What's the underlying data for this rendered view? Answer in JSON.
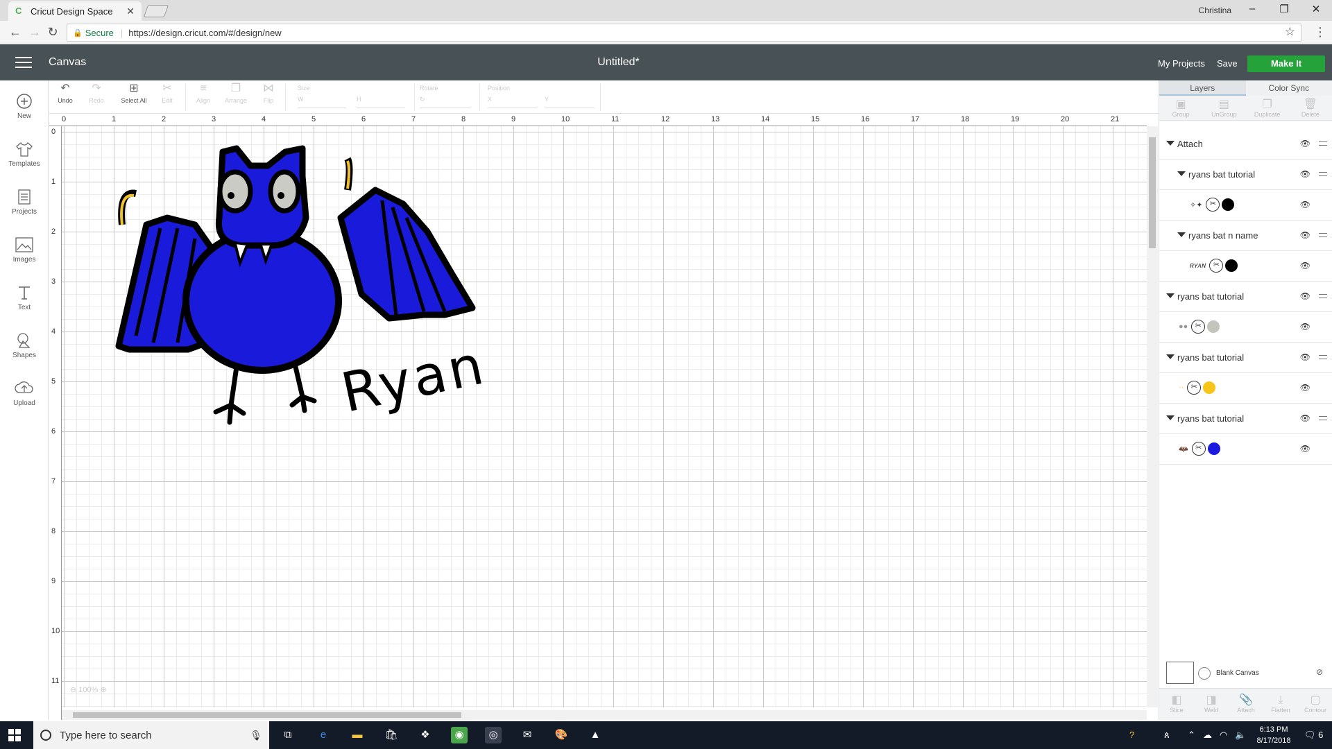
{
  "browser": {
    "tab_title": "Cricut Design Space",
    "user_name": "Christina",
    "secure_label": "Secure",
    "url": "https://design.cricut.com/#/design/new"
  },
  "header": {
    "section": "Canvas",
    "doc_title": "Untitled*",
    "my_projects": "My Projects",
    "save": "Save",
    "make_it": "Make It"
  },
  "sidebar": {
    "items": [
      {
        "label": "New",
        "icon": "plus-circle-icon"
      },
      {
        "label": "Templates",
        "icon": "shirt-icon"
      },
      {
        "label": "Projects",
        "icon": "projects-icon"
      },
      {
        "label": "Images",
        "icon": "image-icon"
      },
      {
        "label": "Text",
        "icon": "text-icon"
      },
      {
        "label": "Shapes",
        "icon": "shapes-icon"
      },
      {
        "label": "Upload",
        "icon": "upload-icon"
      }
    ]
  },
  "toolbar": {
    "undo": "Undo",
    "redo": "Redo",
    "select_all": "Select All",
    "edit": "Edit",
    "align": "Align",
    "arrange": "Arrange",
    "flip": "Flip",
    "size": "Size",
    "w": "W",
    "h": "H",
    "rotate": "Rotate",
    "position": "Position",
    "x": "X",
    "y": "Y"
  },
  "ruler": {
    "h": [
      "0",
      "1",
      "2",
      "3",
      "4",
      "5",
      "6",
      "7",
      "8",
      "9",
      "10",
      "11",
      "12",
      "13",
      "14",
      "15",
      "16",
      "17",
      "18",
      "19",
      "20",
      "21"
    ],
    "v": [
      "0",
      "1",
      "2",
      "3",
      "4",
      "5",
      "6",
      "7",
      "8",
      "9",
      "10",
      "11"
    ]
  },
  "canvas": {
    "zoom": "100%",
    "name_text": "Ryan",
    "colors": {
      "body": "#1a1adb",
      "outline": "#000000",
      "eyes": "#c9cbc4",
      "claws": "#f2c22b"
    }
  },
  "panel": {
    "tabs": [
      "Layers",
      "Color Sync"
    ],
    "tools_top": [
      "Group",
      "UnGroup",
      "Duplicate",
      "Delete"
    ],
    "layers": [
      {
        "name": "Attach",
        "level": 0
      },
      {
        "name": "ryans bat tutorial",
        "level": 1
      },
      {
        "thumb": "bat-outline",
        "swatch": "#000000",
        "level": 2
      },
      {
        "name": "ryans bat n name",
        "level": 1
      },
      {
        "thumb": "ryan",
        "swatch": "#000000",
        "level": 2
      },
      {
        "name": "ryans bat tutorial",
        "level": 0
      },
      {
        "thumb": "eyes",
        "swatch": "#c3c5bd",
        "level": 1
      },
      {
        "name": "ryans bat tutorial",
        "level": 0
      },
      {
        "thumb": "claws",
        "swatch": "#f5c518",
        "level": 1
      },
      {
        "name": "ryans bat tutorial",
        "level": 0
      },
      {
        "thumb": "bat-body",
        "swatch": "#1a1ae0",
        "level": 1
      }
    ],
    "blank_canvas": "Blank Canvas",
    "tools_bottom": [
      "Slice",
      "Weld",
      "Attach",
      "Flatten",
      "Contour"
    ]
  },
  "taskbar": {
    "search_placeholder": "Type here to search",
    "time": "6:13 PM",
    "date": "8/17/2018",
    "notif_count": "6"
  }
}
